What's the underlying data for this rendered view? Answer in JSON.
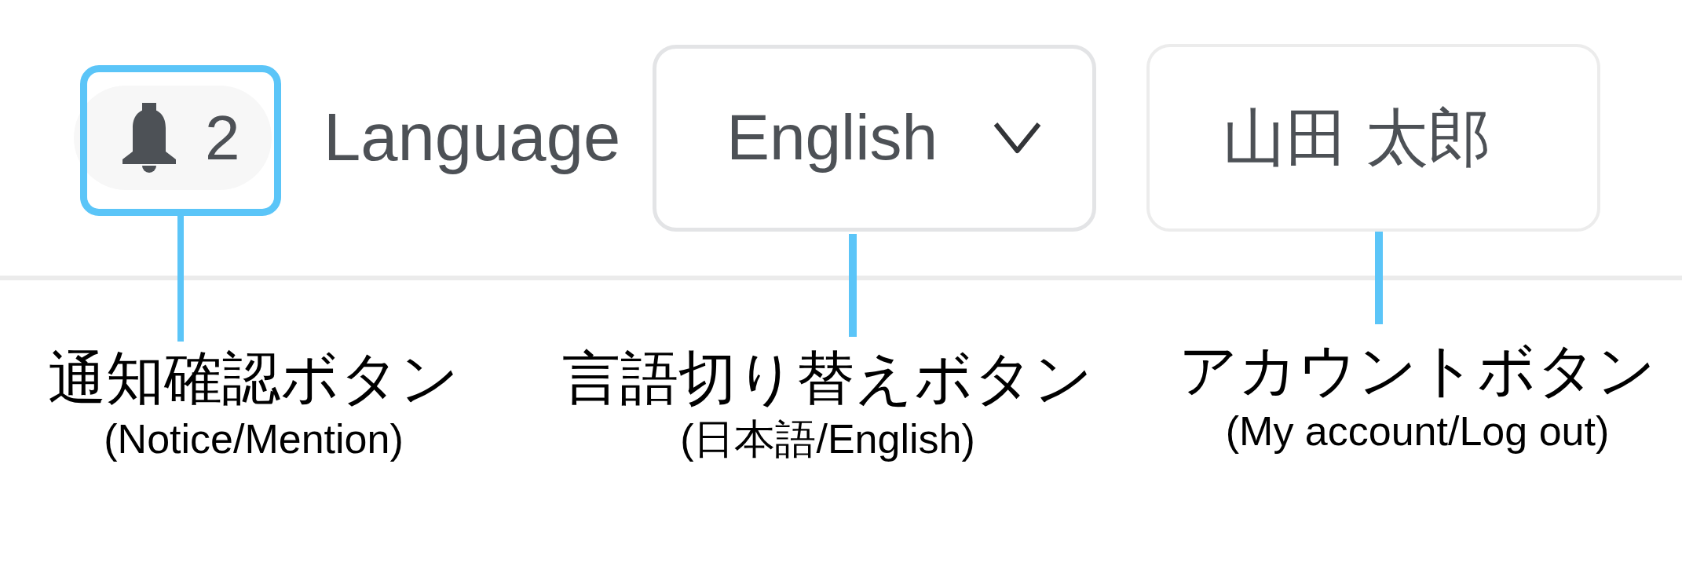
{
  "header": {
    "notification_button": {
      "count": "2",
      "highlighted": true
    },
    "language_label": "Language",
    "language_select": {
      "value": "English"
    },
    "account_button": {
      "label": "山田 太郎"
    }
  },
  "annotations": [
    {
      "title": "通知確認ボタン",
      "subtitle": "(Notice/Mention)"
    },
    {
      "title": "言語切り替えボタン",
      "subtitle": "(日本語/English)"
    },
    {
      "title": "アカウントボタン",
      "subtitle": "(My account/Log out)"
    }
  ]
}
